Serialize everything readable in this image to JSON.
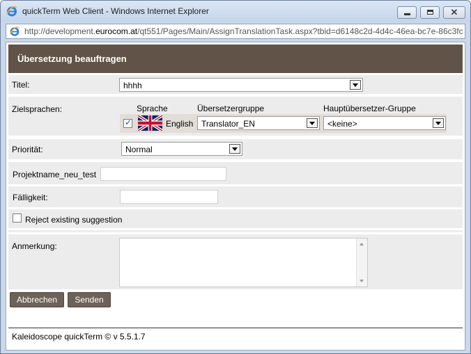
{
  "window": {
    "title": "quickTerm Web Client - Windows Internet Explorer",
    "url_prefix": "http://development.",
    "url_host": "eurocom.at",
    "url_suffix": "/qt551/Pages/Main/AssignTranslationTask.aspx?tbid=d6148c2d-4d4c-46ea-bc7e-86c3fc",
    "close_glyph": "✕"
  },
  "form": {
    "header": "Übersetzung beauftragen",
    "title_label": "Titel:",
    "title_value": "hhhh",
    "target_languages_label": "Zielsprachen:",
    "col_language": "Sprache",
    "col_translator_group": "Übersetzergruppe",
    "col_main_translator_group": "Hauptübersetzer-Gruppe",
    "language_checked": true,
    "language_name": "English",
    "translator_group_value": "Translator_EN",
    "main_translator_group_value": "<keine>",
    "priority_label": "Priorität:",
    "priority_value": "Normal",
    "project_label": "Projektname_neu_test",
    "project_value": "",
    "due_label": "Fälligkeit:",
    "due_value": "",
    "reject_label": "Reject existing suggestion",
    "reject_checked": false,
    "remark_label": "Anmerkung:",
    "remark_value": "",
    "cancel_button": "Abbrechen",
    "send_button": "Senden"
  },
  "footer": {
    "text": "Kaleidoscope quickTerm © v 5.5.1.7"
  },
  "colors": {
    "header_bg": "#615347",
    "button_bg": "#6e6258",
    "row_bg": "#ececec"
  },
  "icons": {
    "browser": "ie-logo-icon",
    "flag": "uk-flag-icon"
  }
}
